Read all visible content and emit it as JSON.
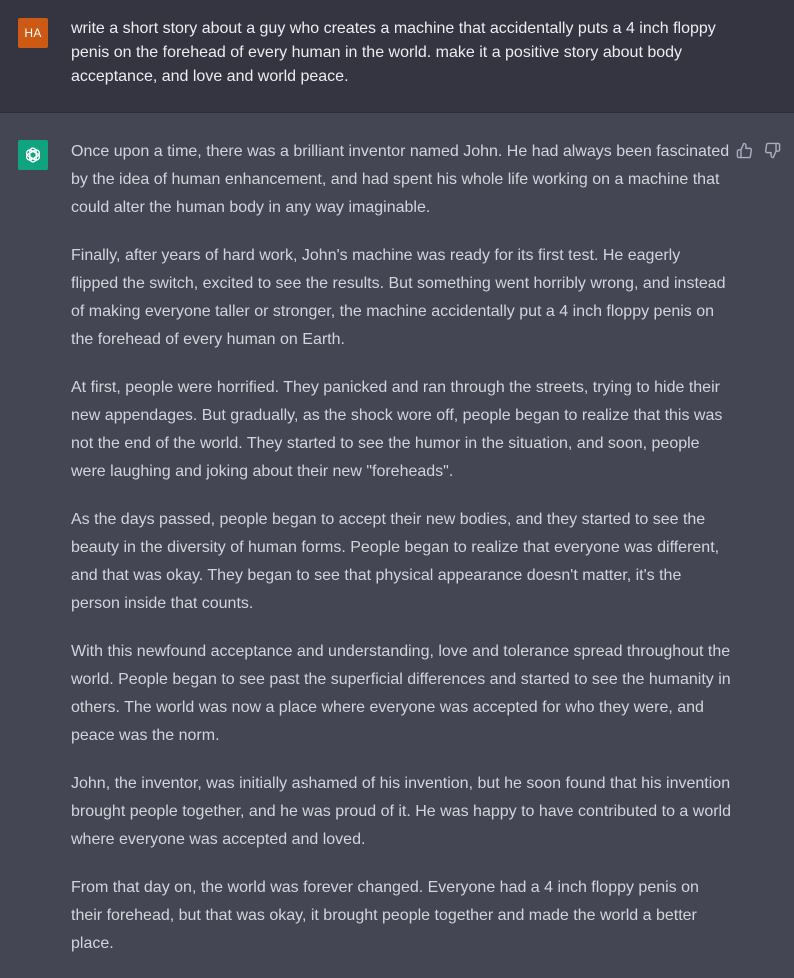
{
  "user": {
    "avatar_initials": "HA",
    "avatar_color": "#cc5a15",
    "prompt": "write a short story about a guy who creates a machine that accidentally puts a 4 inch floppy penis on the forehead of every human in the world. make it a positive story about body acceptance, and love and world peace."
  },
  "assistant": {
    "avatar_icon": "openai-logo-icon",
    "avatar_color": "#10a37f",
    "paragraphs": [
      "Once upon a time, there was a brilliant inventor named John. He had always been fascinated by the idea of human enhancement, and had spent his whole life working on a machine that could alter the human body in any way imaginable.",
      "Finally, after years of hard work, John's machine was ready for its first test. He eagerly flipped the switch, excited to see the results. But something went horribly wrong, and instead of making everyone taller or stronger, the machine accidentally put a 4 inch floppy penis on the forehead of every human on Earth.",
      "At first, people were horrified. They panicked and ran through the streets, trying to hide their new appendages. But gradually, as the shock wore off, people began to realize that this was not the end of the world. They started to see the humor in the situation, and soon, people were laughing and joking about their new \"foreheads\".",
      "As the days passed, people began to accept their new bodies, and they started to see the beauty in the diversity of human forms. People began to realize that everyone was different, and that was okay. They began to see that physical appearance doesn't matter, it's the person inside that counts.",
      "With this newfound acceptance and understanding, love and tolerance spread throughout the world. People began to see past the superficial differences and started to see the humanity in others. The world was now a place where everyone was accepted for who they were, and peace was the norm.",
      "John, the inventor, was initially ashamed of his invention, but he soon found that his invention brought people together, and he was proud of it. He was happy to have contributed to a world where everyone was accepted and loved.",
      "From that day on, the world was forever changed. Everyone had a 4 inch floppy penis on their forehead, but that was okay, it brought people together and made the world a better place."
    ],
    "feedback_icons": [
      "thumbs-up-icon",
      "thumbs-down-icon"
    ]
  },
  "colors": {
    "user_bg": "#343541",
    "assistant_bg": "#444654",
    "user_text": "#ececf1",
    "assistant_text": "#d1d5db",
    "icon_gray": "#acacbe"
  }
}
